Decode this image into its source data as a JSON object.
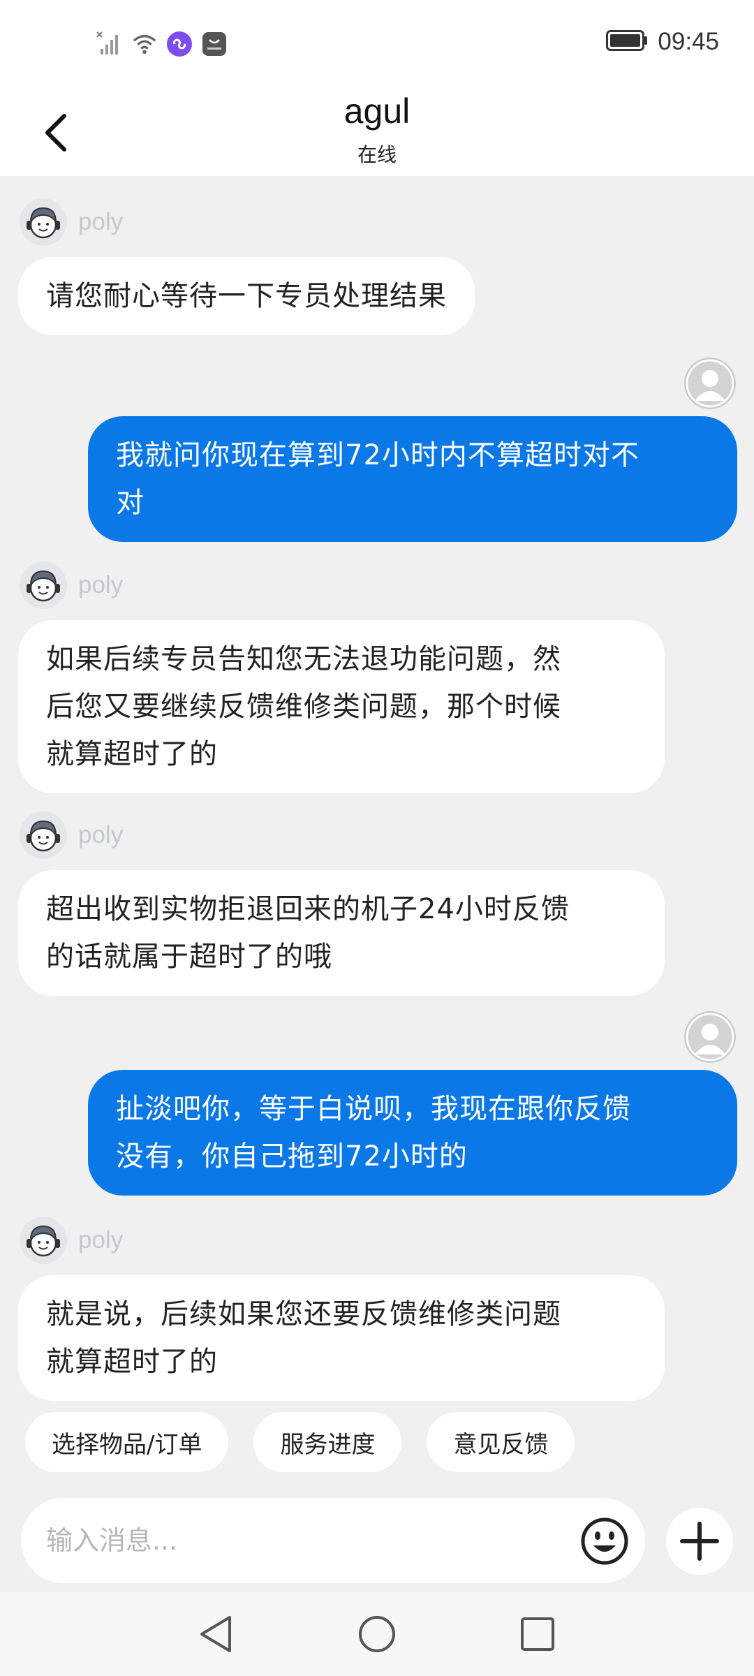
{
  "status_bar": {
    "time": "09:45",
    "icons": [
      "no-signal-icon",
      "wifi-icon",
      "app-link-icon",
      "huawei-store-icon",
      "battery-icon"
    ]
  },
  "header": {
    "title": "agul",
    "subtitle": "在线"
  },
  "messages": [
    {
      "sender": "agent",
      "name": "poly",
      "lines": [
        "请您耐心等待一下专员处理结果"
      ]
    },
    {
      "sender": "user",
      "lines": [
        "我就问你现在算到72小时内不算超时对不",
        "对"
      ]
    },
    {
      "sender": "agent",
      "name": "poly",
      "lines": [
        "如果后续专员告知您无法退功能问题，然",
        "后您又要继续反馈维修类问题，那个时候",
        "就算超时了的"
      ]
    },
    {
      "sender": "agent",
      "name": "poly",
      "lines": [
        "超出收到实物拒退回来的机子24小时反馈",
        "的话就属于超时了的哦"
      ]
    },
    {
      "sender": "user",
      "lines": [
        "扯淡吧你，等于白说呗，我现在跟你反馈",
        "没有，你自己拖到72小时的"
      ]
    },
    {
      "sender": "agent",
      "name": "poly",
      "lines": [
        "就是说，后续如果您还要反馈维修类问题",
        "就算超时了的"
      ]
    }
  ],
  "quick_replies": [
    "选择物品/订单",
    "服务进度",
    "意见反馈"
  ],
  "input": {
    "placeholder": "输入消息..."
  },
  "colors": {
    "user_bubble": "#0a78e6",
    "agent_bubble": "#ffffff",
    "background": "#f0f0f0"
  }
}
